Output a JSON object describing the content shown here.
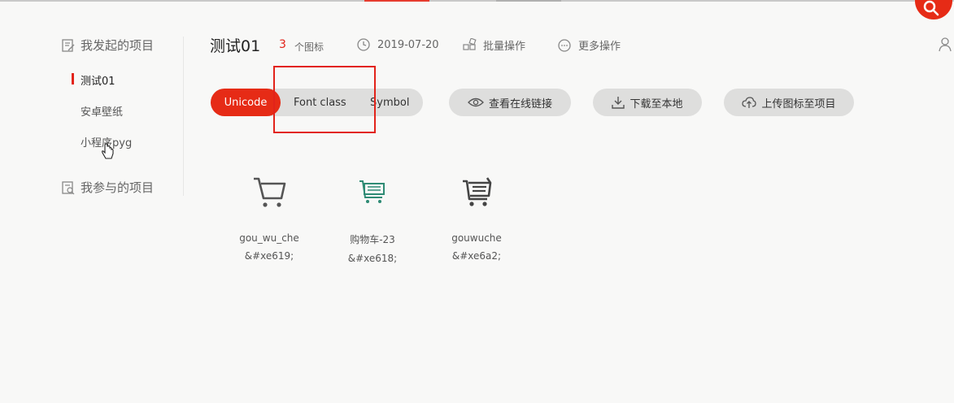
{
  "sidebar": {
    "my_projects_label": "我发起的项目",
    "items": [
      {
        "label": "测试01",
        "active": true
      },
      {
        "label": "安卓壁纸",
        "active": false
      },
      {
        "label": "小程序pyg",
        "active": false
      }
    ],
    "joined_projects_label": "我参与的项目"
  },
  "header": {
    "title": "测试01",
    "icon_count": "3",
    "icon_count_label": "个图标",
    "date": "2019-07-20",
    "batch_label": "批量操作",
    "more_label": "更多操作"
  },
  "toolbar": {
    "tabs": [
      {
        "label": "Unicode",
        "selected": true
      },
      {
        "label": "Font class",
        "selected": false
      },
      {
        "label": "Symbol",
        "selected": false
      }
    ],
    "view_link_label": "查看在线链接",
    "download_label": "下载至本地",
    "upload_label": "上传图标至项目"
  },
  "icons": [
    {
      "name": "gou_wu_che",
      "code": "&#xe619;",
      "icon": "cart-icon",
      "color": "#555555"
    },
    {
      "name": "购物车-23",
      "code": "&#xe618;",
      "icon": "cart-list-icon",
      "color": "#2e8b74"
    },
    {
      "name": "gouwuche",
      "code": "&#xe6a2;",
      "icon": "cart-lines-icon",
      "color": "#444444"
    }
  ],
  "colors": {
    "accent": "#e62b16"
  }
}
